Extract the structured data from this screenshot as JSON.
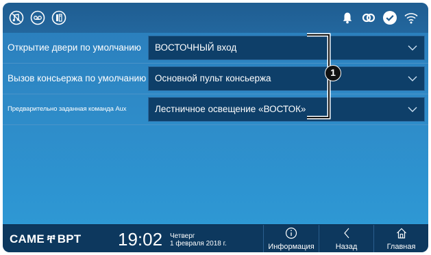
{
  "settings": {
    "rows": [
      {
        "label": "Открытие двери по умолчанию",
        "value": "ВОСТОЧНЫЙ вход"
      },
      {
        "label": "Вызов консьержа по умолчанию",
        "value": "Основной пульт консьержа"
      },
      {
        "label": "Предварительно заданная команда Aux",
        "value": "Лестничное освещение «ВОСТОК»"
      }
    ]
  },
  "callout": {
    "number": "1"
  },
  "footer": {
    "brand_left": "CAME",
    "brand_right": "BPT",
    "time": "19:02",
    "weekday": "Четверг",
    "date": "1 февраля 2018 г.",
    "info_label": "Информация",
    "back_label": "Назад",
    "home_label": "Главная"
  },
  "icons": {
    "statusbar_left": [
      "mute-icon",
      "voicemail-icon",
      "intercom-icon"
    ],
    "statusbar_right": [
      "bell-icon",
      "link-icon",
      "check-icon",
      "wifi-icon"
    ]
  },
  "colors": {
    "accent_dark": "#0d385e",
    "background": "#2e8ac7",
    "select_bg": "#0e3f69"
  }
}
